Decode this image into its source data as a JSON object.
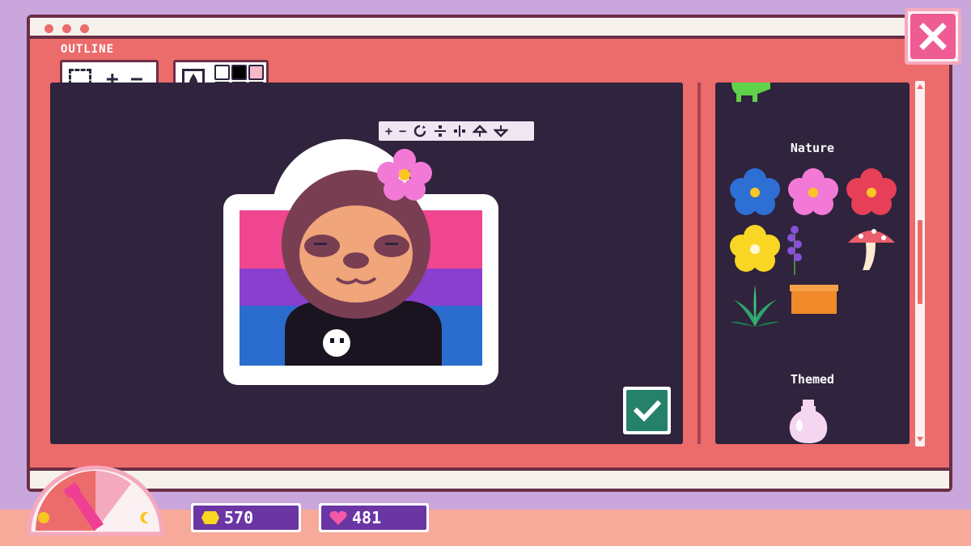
{
  "window": {
    "title": "OUTLINE"
  },
  "tools": {
    "selection_icon": "dashed-square-icon",
    "zoom_in": "+",
    "zoom_out": "−",
    "ink_icon": "ink-drop-icon",
    "swatches": [
      "#ffffff",
      "#000000",
      "#f4b7c8",
      "#fdf1b4",
      "#c1f0c1",
      "#b4e3f5"
    ]
  },
  "sticker_toolbar": {
    "plus": "+",
    "minus": "−"
  },
  "panel": {
    "nature_heading": "Nature",
    "themed_heading": "Themed",
    "nature_items": [
      "blue-flower",
      "pink-flower",
      "red-flower",
      "yellow-flower",
      "lavender",
      "mushroom",
      "fern",
      "planter-box"
    ],
    "themed_items": [
      "potion-bottle"
    ]
  },
  "hud": {
    "coins": "570",
    "hearts": "481"
  },
  "colors": {
    "flag_pink": "#f0458f",
    "flag_purple": "#8a3fcf",
    "flag_blue": "#2b6ccf",
    "accent": "#ec6b6b"
  }
}
